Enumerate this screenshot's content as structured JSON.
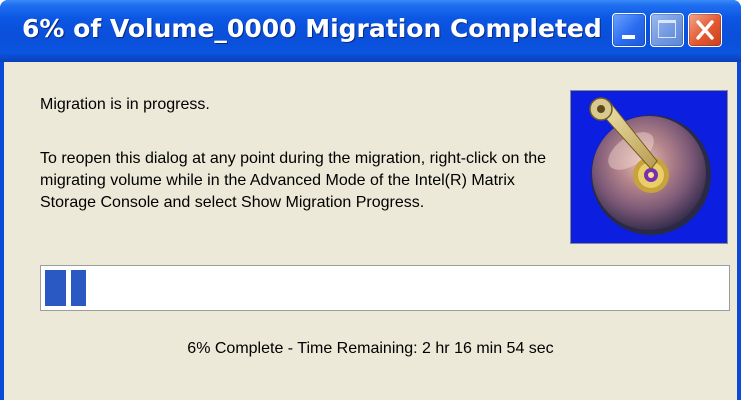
{
  "window": {
    "title": "6% of Volume_0000 Migration Completed",
    "controls": {
      "minimize": "minimize-icon",
      "maximize": "maximize-icon",
      "close": "close-icon"
    }
  },
  "message": {
    "line1": "Migration is in progress.",
    "line2": "To reopen this dialog at any point during the migration, right-click on the migrating volume while in the Advanced Mode of the Intel(R) Matrix Storage Console and select Show Migration Progress."
  },
  "picture": {
    "icon": "hard-disk-icon"
  },
  "progress": {
    "percent": 6
  },
  "status": {
    "text": "6% Complete - Time Remaining: 2 hr 16 min 54 sec"
  },
  "colors": {
    "titlebar": "#0a4fd9",
    "client_bg": "#ece9d8",
    "progress_fill": "#2b59c4",
    "close_button": "#e3582f"
  }
}
